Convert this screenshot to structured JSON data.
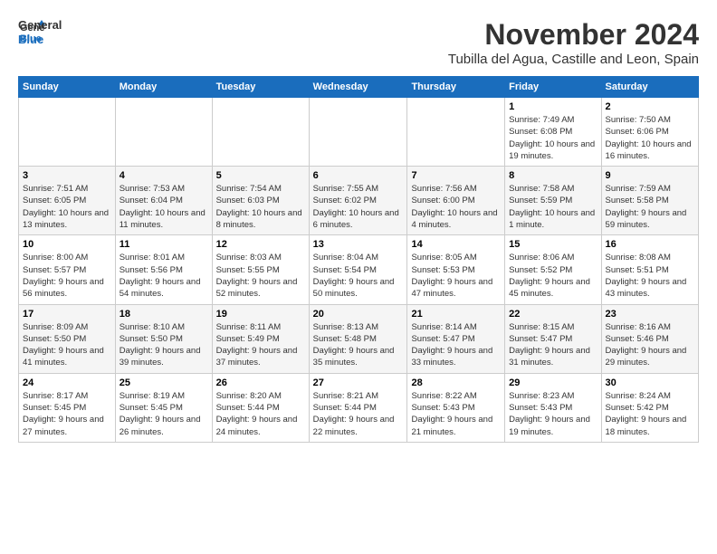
{
  "logo": {
    "line1": "General",
    "line2": "Blue"
  },
  "title": "November 2024",
  "location": "Tubilla del Agua, Castille and Leon, Spain",
  "days_of_week": [
    "Sunday",
    "Monday",
    "Tuesday",
    "Wednesday",
    "Thursday",
    "Friday",
    "Saturday"
  ],
  "weeks": [
    [
      {
        "day": "",
        "info": ""
      },
      {
        "day": "",
        "info": ""
      },
      {
        "day": "",
        "info": ""
      },
      {
        "day": "",
        "info": ""
      },
      {
        "day": "",
        "info": ""
      },
      {
        "day": "1",
        "info": "Sunrise: 7:49 AM\nSunset: 6:08 PM\nDaylight: 10 hours and 19 minutes."
      },
      {
        "day": "2",
        "info": "Sunrise: 7:50 AM\nSunset: 6:06 PM\nDaylight: 10 hours and 16 minutes."
      }
    ],
    [
      {
        "day": "3",
        "info": "Sunrise: 7:51 AM\nSunset: 6:05 PM\nDaylight: 10 hours and 13 minutes."
      },
      {
        "day": "4",
        "info": "Sunrise: 7:53 AM\nSunset: 6:04 PM\nDaylight: 10 hours and 11 minutes."
      },
      {
        "day": "5",
        "info": "Sunrise: 7:54 AM\nSunset: 6:03 PM\nDaylight: 10 hours and 8 minutes."
      },
      {
        "day": "6",
        "info": "Sunrise: 7:55 AM\nSunset: 6:02 PM\nDaylight: 10 hours and 6 minutes."
      },
      {
        "day": "7",
        "info": "Sunrise: 7:56 AM\nSunset: 6:00 PM\nDaylight: 10 hours and 4 minutes."
      },
      {
        "day": "8",
        "info": "Sunrise: 7:58 AM\nSunset: 5:59 PM\nDaylight: 10 hours and 1 minute."
      },
      {
        "day": "9",
        "info": "Sunrise: 7:59 AM\nSunset: 5:58 PM\nDaylight: 9 hours and 59 minutes."
      }
    ],
    [
      {
        "day": "10",
        "info": "Sunrise: 8:00 AM\nSunset: 5:57 PM\nDaylight: 9 hours and 56 minutes."
      },
      {
        "day": "11",
        "info": "Sunrise: 8:01 AM\nSunset: 5:56 PM\nDaylight: 9 hours and 54 minutes."
      },
      {
        "day": "12",
        "info": "Sunrise: 8:03 AM\nSunset: 5:55 PM\nDaylight: 9 hours and 52 minutes."
      },
      {
        "day": "13",
        "info": "Sunrise: 8:04 AM\nSunset: 5:54 PM\nDaylight: 9 hours and 50 minutes."
      },
      {
        "day": "14",
        "info": "Sunrise: 8:05 AM\nSunset: 5:53 PM\nDaylight: 9 hours and 47 minutes."
      },
      {
        "day": "15",
        "info": "Sunrise: 8:06 AM\nSunset: 5:52 PM\nDaylight: 9 hours and 45 minutes."
      },
      {
        "day": "16",
        "info": "Sunrise: 8:08 AM\nSunset: 5:51 PM\nDaylight: 9 hours and 43 minutes."
      }
    ],
    [
      {
        "day": "17",
        "info": "Sunrise: 8:09 AM\nSunset: 5:50 PM\nDaylight: 9 hours and 41 minutes."
      },
      {
        "day": "18",
        "info": "Sunrise: 8:10 AM\nSunset: 5:50 PM\nDaylight: 9 hours and 39 minutes."
      },
      {
        "day": "19",
        "info": "Sunrise: 8:11 AM\nSunset: 5:49 PM\nDaylight: 9 hours and 37 minutes."
      },
      {
        "day": "20",
        "info": "Sunrise: 8:13 AM\nSunset: 5:48 PM\nDaylight: 9 hours and 35 minutes."
      },
      {
        "day": "21",
        "info": "Sunrise: 8:14 AM\nSunset: 5:47 PM\nDaylight: 9 hours and 33 minutes."
      },
      {
        "day": "22",
        "info": "Sunrise: 8:15 AM\nSunset: 5:47 PM\nDaylight: 9 hours and 31 minutes."
      },
      {
        "day": "23",
        "info": "Sunrise: 8:16 AM\nSunset: 5:46 PM\nDaylight: 9 hours and 29 minutes."
      }
    ],
    [
      {
        "day": "24",
        "info": "Sunrise: 8:17 AM\nSunset: 5:45 PM\nDaylight: 9 hours and 27 minutes."
      },
      {
        "day": "25",
        "info": "Sunrise: 8:19 AM\nSunset: 5:45 PM\nDaylight: 9 hours and 26 minutes."
      },
      {
        "day": "26",
        "info": "Sunrise: 8:20 AM\nSunset: 5:44 PM\nDaylight: 9 hours and 24 minutes."
      },
      {
        "day": "27",
        "info": "Sunrise: 8:21 AM\nSunset: 5:44 PM\nDaylight: 9 hours and 22 minutes."
      },
      {
        "day": "28",
        "info": "Sunrise: 8:22 AM\nSunset: 5:43 PM\nDaylight: 9 hours and 21 minutes."
      },
      {
        "day": "29",
        "info": "Sunrise: 8:23 AM\nSunset: 5:43 PM\nDaylight: 9 hours and 19 minutes."
      },
      {
        "day": "30",
        "info": "Sunrise: 8:24 AM\nSunset: 5:42 PM\nDaylight: 9 hours and 18 minutes."
      }
    ]
  ]
}
